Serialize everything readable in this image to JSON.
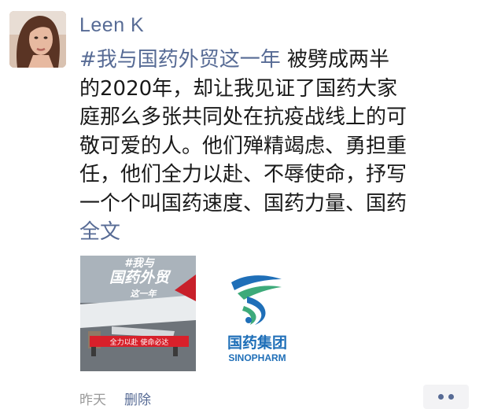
{
  "post": {
    "author": "Leen K",
    "hashtag": "#我与国药外贸这一年",
    "body_lines": [
      " 被劈成两半",
      "的2020年，却让我见证了国药大家",
      "庭那么多张共同处在抗疫战线上的可",
      "敬可爱的人。他们殚精竭虑、勇担重",
      "任，他们全力以赴、不辱使命，抒写",
      "一个个叫国药速度、国药力量、国药"
    ],
    "expand_label": "全文",
    "time": "昨天",
    "delete_label": "删除",
    "more_icon": "more-dots-icon"
  },
  "images": {
    "photo": {
      "title_line1": "#我与",
      "title_line2": "国药外贸",
      "title_line3": "这一年",
      "banner": "全力以赴 使命必达"
    },
    "logo": {
      "name_cn": "国药集团",
      "name_en": "SINOPHARM",
      "colors": {
        "blue": "#1f6fb8",
        "green": "#3daa7a",
        "red": "#e0342c"
      }
    }
  },
  "colors": {
    "link": "#576b95",
    "text": "#191919",
    "meta": "#9a9a9a"
  }
}
